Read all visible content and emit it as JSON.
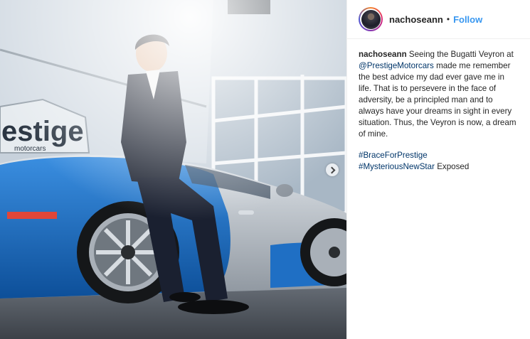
{
  "post": {
    "username": "nachoseann",
    "separator": "•",
    "follow_label": "Follow",
    "caption": {
      "username": "nachoseann",
      "text_before": " Seeing the Bugatti Veyron at ",
      "mention": "@PrestigeMotorcars",
      "text_after": " made me remember the best advice my dad ever gave me in life. That is to persevere in the face of adversity, be a principled man and to always have your dreams in sight in every situation. Thus, the Veyron is now, a dream of mine."
    },
    "hashtags": [
      {
        "tag": "#BraceForPrestige",
        "suffix": ""
      },
      {
        "tag": "#MysteriousNewStar",
        "suffix": " Exposed"
      }
    ]
  },
  "photo": {
    "sign_text": "estige",
    "sign_subtext": "motorcars",
    "icons": {
      "next": "chevron-right-icon"
    }
  },
  "colors": {
    "link": "#003569",
    "follow": "#3897f0",
    "car_blue": "#1f6fc4",
    "car_silver": "#b9c0c8"
  }
}
